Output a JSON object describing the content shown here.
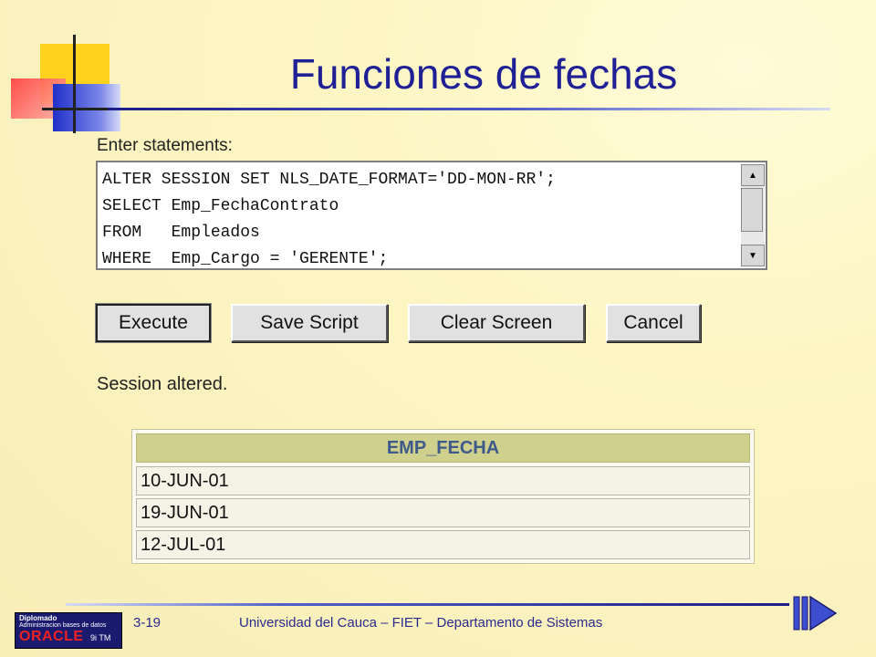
{
  "slide": {
    "title": "Funciones de fechas",
    "page_number": "3-19",
    "footer": "Universidad del Cauca – FIET – Departamento de Sistemas",
    "logo": {
      "line1": "Diplomado",
      "line2": "Administracion bases de datos",
      "brand": "ORACLE",
      "suffix": "9i TM"
    }
  },
  "sql_panel": {
    "label": "Enter statements:",
    "text": "ALTER SESSION SET NLS_DATE_FORMAT='DD-MON-RR';\nSELECT Emp_FechaContrato\nFROM   Empleados\nWHERE  Emp_Cargo = 'GERENTE';"
  },
  "buttons": {
    "execute": "Execute",
    "save_script": "Save Script",
    "clear_screen": "Clear Screen",
    "cancel": "Cancel"
  },
  "output": {
    "message": "Session altered.",
    "table": {
      "header": "EMP_FECHA",
      "rows": [
        "10-JUN-01",
        "19-JUN-01",
        "12-JUL-01"
      ]
    }
  },
  "colors": {
    "title": "#1f1f96",
    "table_header_bg": "#cfcf8e",
    "table_header_text": "#3d5a8a"
  }
}
